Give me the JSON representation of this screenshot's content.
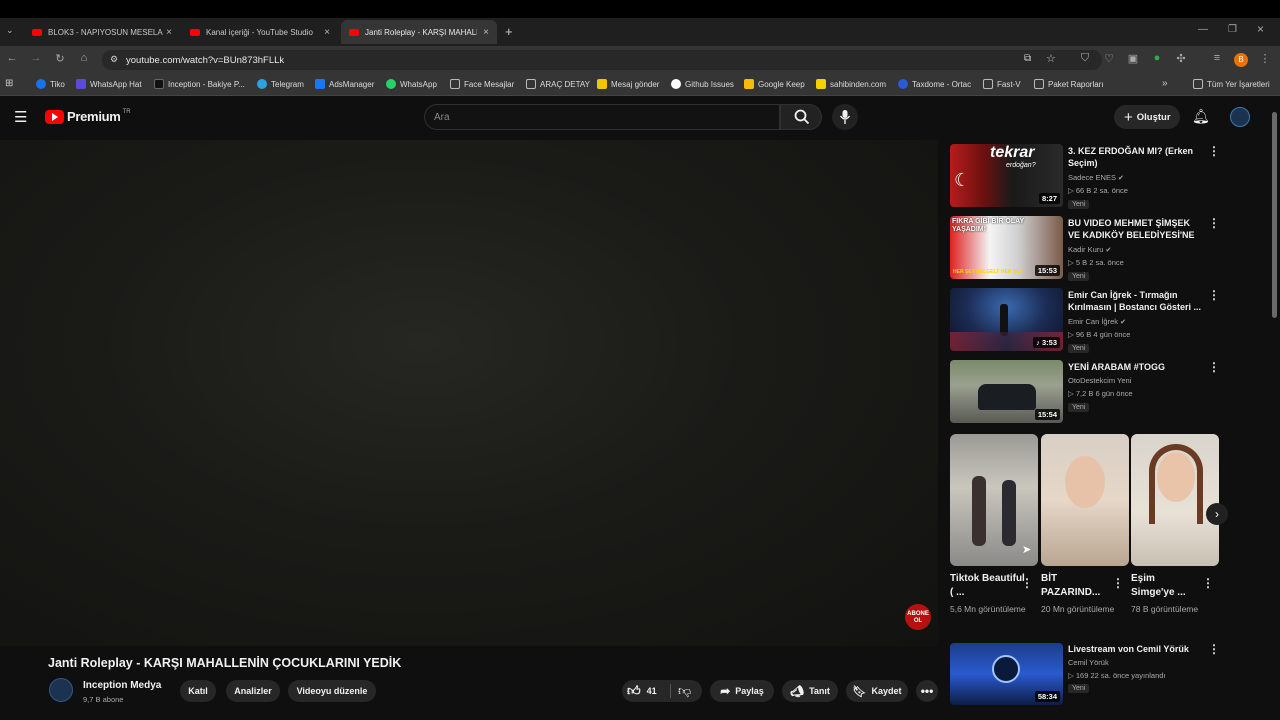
{
  "browser": {
    "tabs": [
      {
        "label": "BLOK3 - NAPIYOSUN MESELA"
      },
      {
        "label": "Kanal içeriği - YouTube Studio"
      },
      {
        "label": "Janti Roleplay - KARŞI MAHALL"
      }
    ],
    "url": "youtube.com/watch?v=BUn873hFLLk",
    "bookmarks": [
      {
        "label": "Tiko",
        "color": "#1a73e8"
      },
      {
        "label": "WhatsApp Hat",
        "color": "#5b4bd8"
      },
      {
        "label": "Inception - Bakiye P...",
        "color": "#111"
      },
      {
        "label": "Telegram",
        "color": "#2aa3e0"
      },
      {
        "label": "AdsManager",
        "color": "#1877f2"
      },
      {
        "label": "WhatsApp",
        "color": "#25d366"
      },
      {
        "label": "Face Mesajlar",
        "color": "#888"
      },
      {
        "label": "ARAÇ DETAY",
        "color": "#888"
      },
      {
        "label": "Mesaj gönder",
        "color": "#f5c400"
      },
      {
        "label": "Github Issues",
        "color": "#fff"
      },
      {
        "label": "Google Keep",
        "color": "#f9bb0a"
      },
      {
        "label": "sahibinden.com",
        "color": "#f5d100"
      },
      {
        "label": "Taxdome - Ortac",
        "color": "#2a5bd7"
      },
      {
        "label": "Fast-V",
        "color": "#888"
      },
      {
        "label": "Paket Raporları",
        "color": "#888"
      }
    ],
    "all_bookmarks": "Tüm Yer İşaretleri"
  },
  "yt": {
    "logo": "Premium",
    "logo_sup": "TR",
    "search_placeholder": "Ara",
    "create_label": "Oluştur"
  },
  "video": {
    "title": "Janti Roleplay - KARŞI MAHALLENİN ÇOCUKLARINI YEDİK",
    "channel": "Inception Medya",
    "subs": "9,7 B abone",
    "abone_text": "ABONE OL",
    "buttons": {
      "join": "Katıl",
      "analytics": "Analizler",
      "edit": "Videoyu düzenle",
      "likes": "41",
      "share": "Paylaş",
      "promote": "Tanıt",
      "save": "Kaydet"
    }
  },
  "sidebar": {
    "videos": [
      {
        "title": "3. KEZ ERDOĞAN MI? (Erken Seçim)",
        "channel": "Sadece ENES",
        "meta": "▷ 66 B   2 sa. önce",
        "badge": "Yeni",
        "duration": "8:27"
      },
      {
        "title": "BU VIDEO MEHMET ŞİMŞEK VE KADIKÖY BELEDİYESİ'NE",
        "channel": "Kadir Kuru",
        "meta": "▷ 5 B   2 sa. önce",
        "badge": "Yeni",
        "duration": "15:53"
      },
      {
        "title": "Emir Can İğrek - Tırmağın Kırılmasın | Bostancı Gösteri ...",
        "channel": "Emir Can İğrek",
        "meta": "▷ 96 B   4 gün önce",
        "badge": "Yeni",
        "duration": "3:53"
      },
      {
        "title": "YENİ ARABAM #TOGG",
        "channel": "OtoDestekcim Yeni",
        "meta": "▷ 7,2 B   6 gün önce",
        "badge": "Yeni",
        "duration": "15:54"
      }
    ],
    "thumb_texts": {
      "t1": "tekrar",
      "t1b": "erdoğan?",
      "t2": "FIKRA GİBİ BİR OLAY YAŞADIM!",
      "t2b": "HER ŞEY BELGELİ! HER ŞEY"
    },
    "shorts": [
      {
        "title": "Tiktok Beautiful ( ...",
        "views": "5,6 Mn görüntüleme"
      },
      {
        "title": "BİT PAZARIND...",
        "views": "20 Mn görüntüleme"
      },
      {
        "title": "Eşim Simge'ye ...",
        "views": "78 B görüntüleme"
      }
    ],
    "live": {
      "title": "Livestream von Cemil Yörük",
      "channel": "Cemil Yörük",
      "meta": "▷ 169   22 sa. önce yayınlandı",
      "badge": "Yeni",
      "duration": "58:34"
    }
  },
  "colors": {
    "yt_red": "#ff0000",
    "bg": "#0f0f0f"
  }
}
